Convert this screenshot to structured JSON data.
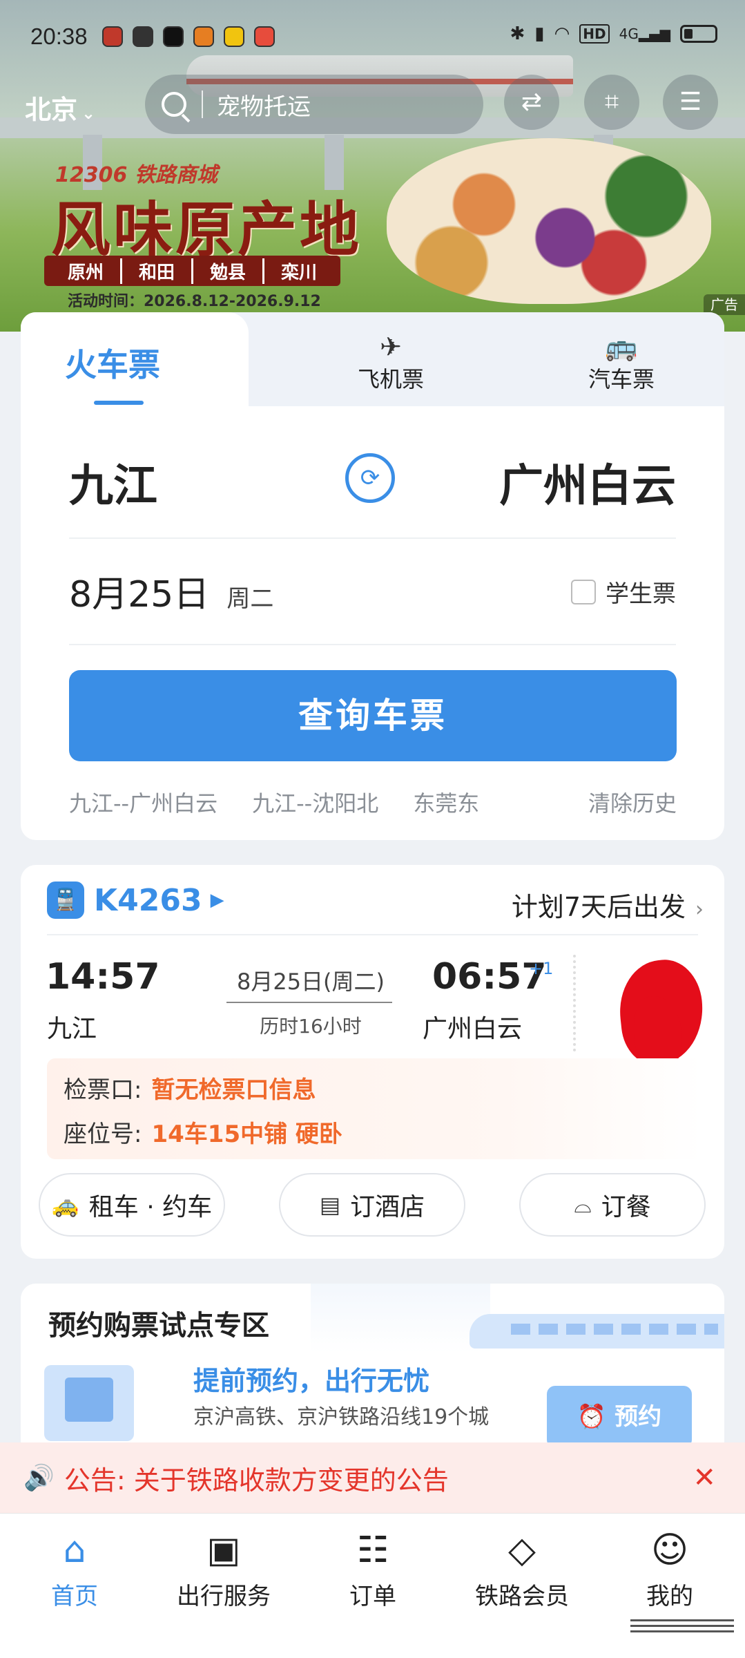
{
  "status_bar": {
    "time": "20:38",
    "network": "4G",
    "hd": "HD"
  },
  "header": {
    "city": "北京",
    "search_placeholder": "宠物托运"
  },
  "banner": {
    "logo": "12306 铁路商城",
    "title": "风味原产地",
    "places": [
      "原州",
      "和田",
      "勉县",
      "栾川"
    ],
    "date": "活动时间：2026.8.12-2026.9.12",
    "ad_label": "广告"
  },
  "tabs": {
    "train": "火车票",
    "plane": "飞机票",
    "bus": "汽车票"
  },
  "search_form": {
    "from": "九江",
    "to": "广州白云",
    "date": "8月25日",
    "weekday": "周二",
    "student": "学生票",
    "query_button": "查询车票",
    "history": [
      "九江--广州白云",
      "九江--沈阳北",
      "东莞东"
    ],
    "clear_history": "清除历史"
  },
  "trip": {
    "train_code": "K4263",
    "plan": "计划7天后出发",
    "dep_time": "14:57",
    "dep_station": "九江",
    "date": "8月25日(周二)",
    "duration": "历时16小时",
    "arr_time": "06:57",
    "arr_plus": "+1",
    "arr_station": "广州白云",
    "gate_label": "检票口:",
    "gate_value": "暂无检票口信息",
    "seat_label": "座位号:",
    "seat_value": "14车15中铺 硬卧",
    "services": [
      "租车 · 约车",
      "订酒店",
      "订餐"
    ]
  },
  "reserve": {
    "title": "预约购票试点专区",
    "headline": "提前预约，出行无忧",
    "subtitle": "京沪高铁、京沪铁路沿线19个城",
    "button": "预约"
  },
  "notice": {
    "label": "公告:",
    "text": "关于铁路收款方变更的公告"
  },
  "nav": {
    "items": [
      {
        "label": "首页",
        "icon": "home-icon"
      },
      {
        "label": "出行服务",
        "icon": "luggage-icon"
      },
      {
        "label": "订单",
        "icon": "order-icon"
      },
      {
        "label": "铁路会员",
        "icon": "member-icon"
      },
      {
        "label": "我的",
        "icon": "profile-icon"
      }
    ]
  },
  "colors": {
    "accent": "#3a8ee6",
    "warning": "#f0692b",
    "notice": "#e4352b"
  }
}
